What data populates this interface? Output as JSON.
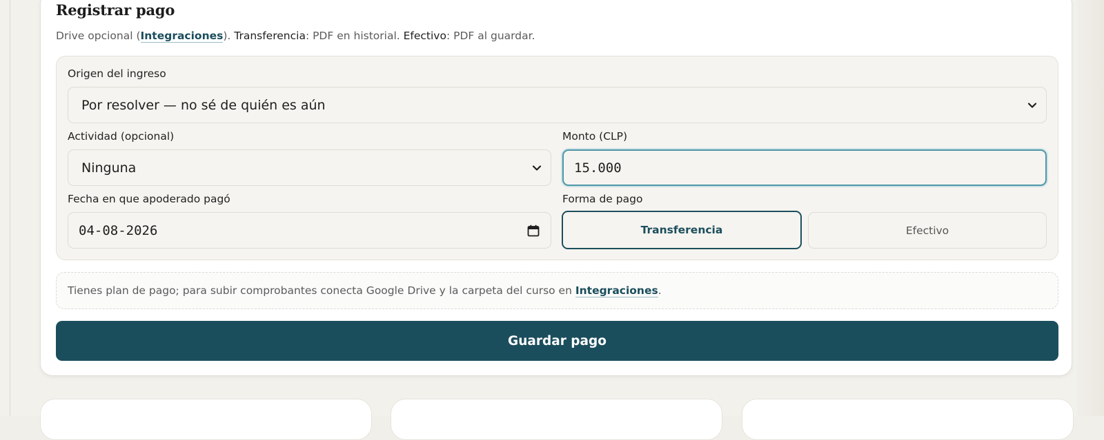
{
  "form": {
    "title": "Registrar pago",
    "subtitle": {
      "part1": "Drive opcional (",
      "link": "Integraciones",
      "part2": "). ",
      "transfer_word": "Transferencia",
      "part3": ": PDF en historial. ",
      "cash_word": "Efectivo",
      "part4": ": PDF al guardar."
    },
    "origin": {
      "label": "Origen del ingreso",
      "selected": "Por resolver — no sé de quién es aún"
    },
    "activity": {
      "label": "Actividad (opcional)",
      "selected": "Ninguna"
    },
    "amount": {
      "label": "Monto (CLP)",
      "value": "15.000"
    },
    "date": {
      "label": "Fecha en que apoderado pagó",
      "value": "04-08-2026"
    },
    "payment_method": {
      "label": "Forma de pago",
      "options": [
        "Transferencia",
        "Efectivo"
      ],
      "selected": "Transferencia"
    },
    "info": {
      "text": "Tienes plan de pago; para subir comprobantes conecta Google Drive y la carpeta del curso en ",
      "link": "Integraciones",
      "end": "."
    },
    "save_label": "Guardar pago"
  },
  "colors": {
    "accent": "#1b4e5c",
    "focus_ring": "#4e97a6",
    "panel": "#f6f4f0",
    "background": "#f3f1ec"
  },
  "icons": {
    "select_chevron": "chevron-down-icon",
    "date_picker": "calendar-icon"
  }
}
